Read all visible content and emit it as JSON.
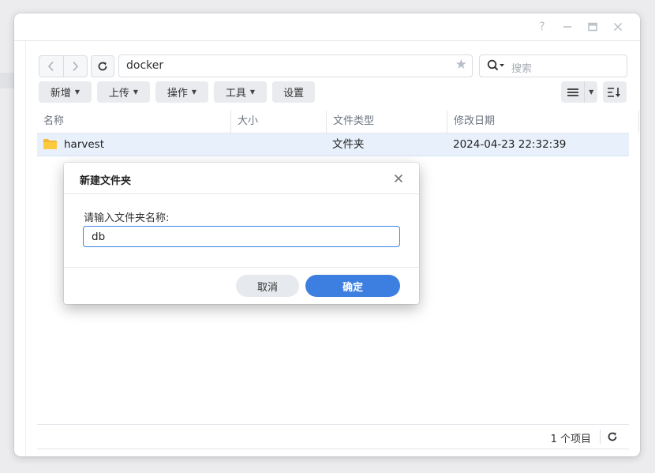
{
  "window": {
    "controls": {
      "help": "?",
      "minimize_icon": "minimize-icon",
      "maximize_icon": "maximize-icon",
      "close_icon": "close-icon"
    }
  },
  "address_bar": {
    "path": "docker",
    "search_placeholder": "搜索"
  },
  "toolbar": {
    "create_label": "新增",
    "upload_label": "上传",
    "action_label": "操作",
    "tools_label": "工具",
    "settings_label": "设置"
  },
  "table": {
    "columns": [
      "名称",
      "大小",
      "文件类型",
      "修改日期"
    ],
    "rows": [
      {
        "name": "harvest",
        "size": "",
        "type": "文件夹",
        "modified": "2024-04-23 22:32:39"
      }
    ]
  },
  "status": {
    "item_count": "1 个项目"
  },
  "dialog": {
    "title": "新建文件夹",
    "prompt": "请输入文件夹名称:",
    "input_value": "db",
    "cancel_label": "取消",
    "ok_label": "确定"
  },
  "colors": {
    "accent": "#3d7fe0",
    "selected_row": "#e8f1fb",
    "folder": "#f5b731"
  }
}
